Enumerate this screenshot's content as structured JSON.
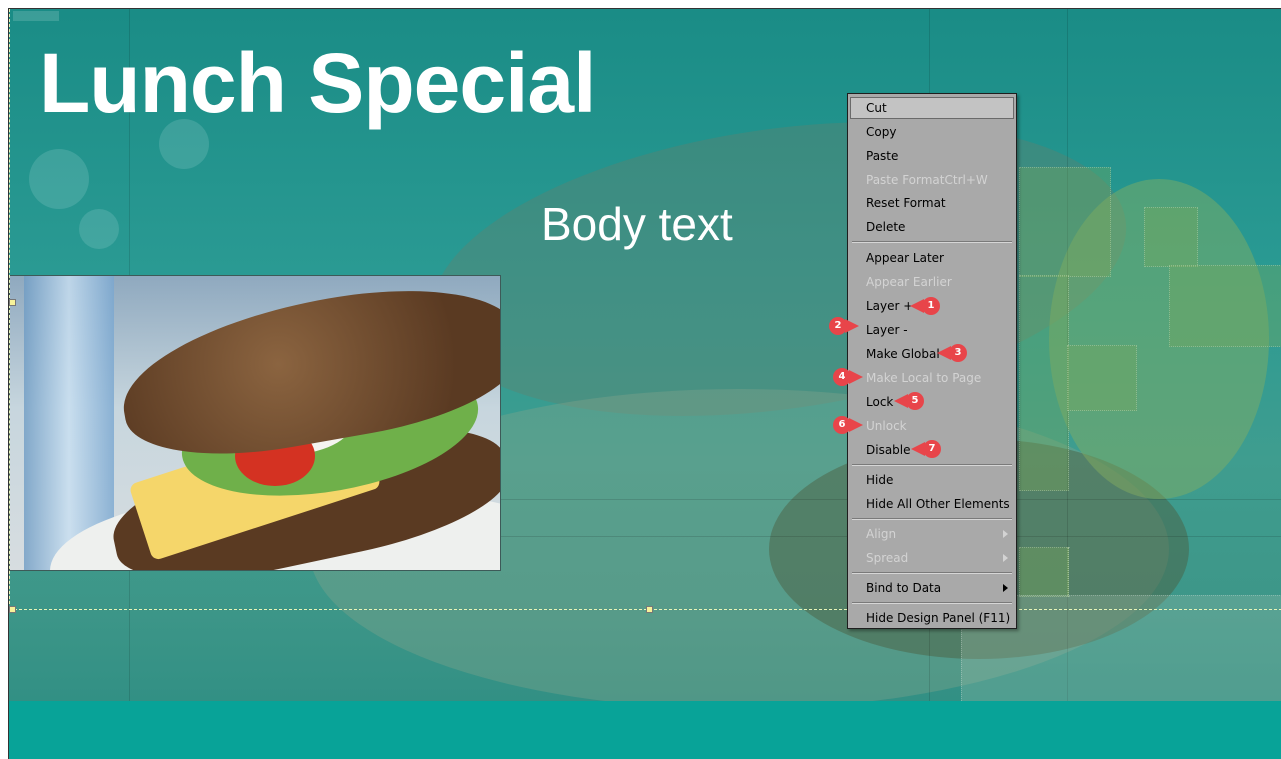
{
  "slide": {
    "title": "Lunch Special",
    "body_text": "Body text"
  },
  "context_menu": {
    "items": [
      {
        "label": "Cut",
        "enabled": true
      },
      {
        "label": "Copy",
        "enabled": true
      },
      {
        "label": "Paste",
        "enabled": true
      },
      {
        "label": "Paste FormatCtrl+W",
        "enabled": false
      },
      {
        "label": "Reset Format",
        "enabled": true
      },
      {
        "label": "Delete",
        "enabled": true
      },
      {
        "label": "Appear Later",
        "enabled": true
      },
      {
        "label": "Appear Earlier",
        "enabled": false
      },
      {
        "label": "Layer +",
        "enabled": true
      },
      {
        "label": "Layer -",
        "enabled": true
      },
      {
        "label": "Make Global",
        "enabled": true
      },
      {
        "label": "Make Local to Page",
        "enabled": false
      },
      {
        "label": "Lock",
        "enabled": true
      },
      {
        "label": "Unlock",
        "enabled": false
      },
      {
        "label": "Disable",
        "enabled": true
      },
      {
        "label": "Hide",
        "enabled": true
      },
      {
        "label": "Hide All Other Elements",
        "enabled": true
      },
      {
        "label": "Align",
        "enabled": false,
        "submenu": true
      },
      {
        "label": "Spread",
        "enabled": false,
        "submenu": true
      },
      {
        "label": "Bind to Data",
        "enabled": true,
        "submenu": true
      },
      {
        "label": "Hide Design Panel (F11)",
        "enabled": true
      }
    ]
  },
  "markers": [
    "1",
    "2",
    "3",
    "4",
    "5",
    "6",
    "7"
  ],
  "colors": {
    "background_teal": "#1a8c86",
    "bottom_bar": "#08a398",
    "menu_bg": "#a9a9a9",
    "marker_red": "#e8454a"
  }
}
